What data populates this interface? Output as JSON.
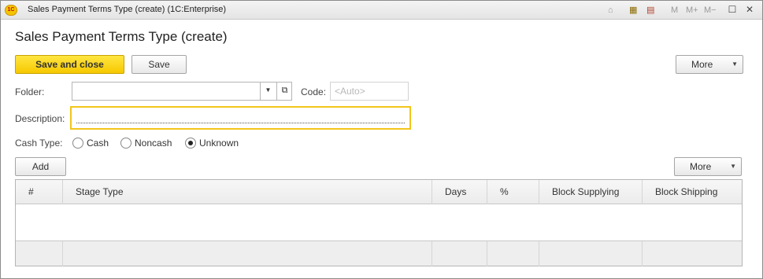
{
  "window": {
    "title": "Sales Payment Terms Type (create)  (1C:Enterprise)",
    "logo_text": "1C",
    "controls": [
      "M",
      "M+",
      "M−"
    ]
  },
  "form": {
    "title": "Sales Payment Terms Type (create)"
  },
  "toolbar": {
    "save_and_close": "Save and close",
    "save": "Save",
    "more": "More"
  },
  "fields": {
    "folder_label": "Folder:",
    "folder_value": "",
    "code_label": "Code:",
    "code_placeholder": "<Auto>",
    "description_label": "Description:",
    "description_value": ""
  },
  "cash_type": {
    "label": "Cash Type:",
    "options": [
      {
        "label": "Cash",
        "selected": false
      },
      {
        "label": "Noncash",
        "selected": false
      },
      {
        "label": "Unknown",
        "selected": true
      }
    ]
  },
  "table_toolbar": {
    "add": "Add",
    "more": "More"
  },
  "table": {
    "columns": [
      "#",
      "Stage Type",
      "Days",
      "%",
      "Block Supplying",
      "Block Shipping"
    ],
    "rows": []
  },
  "colors": {
    "accent": "#f6c800",
    "focus_border": "#f2c51a"
  }
}
